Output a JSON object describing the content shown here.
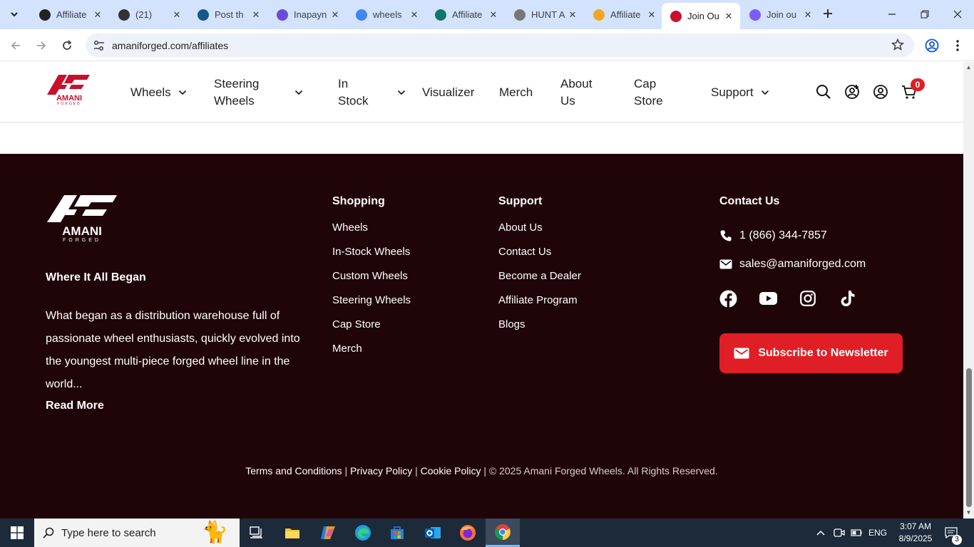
{
  "browser": {
    "tabs": [
      {
        "title": "Affiliate",
        "favicon": "chatgpt-icon",
        "color": "#222222"
      },
      {
        "title": "(21)",
        "favicon": "b-icon",
        "color": "#333333"
      },
      {
        "title": "Post th",
        "favicon": "xf-icon",
        "color": "#185886"
      },
      {
        "title": "Inapayn",
        "favicon": "e-icon",
        "color": "#6b4cd6"
      },
      {
        "title": "wheels",
        "favicon": "google-icon",
        "color": "#4285f4"
      },
      {
        "title": "Affiliate",
        "favicon": "shield-check-icon",
        "color": "#0f766e"
      },
      {
        "title": "HUNT A",
        "favicon": "slash-icon",
        "color": "#777777"
      },
      {
        "title": "Affiliate",
        "favicon": "sun-icon",
        "color": "#f5a623"
      },
      {
        "title": "Join Ou",
        "favicon": "amani-icon",
        "color": "#c8102e"
      },
      {
        "title": "Join ou",
        "favicon": "globe-icon",
        "color": "#7c5cff"
      }
    ],
    "active_tab_index": 8,
    "address": "amaniforged.com/affiliates"
  },
  "header": {
    "nav": [
      {
        "label": "Wheels",
        "dropdown": true
      },
      {
        "label": "Steering\nWheels",
        "dropdown": true
      },
      {
        "label": "In\nStock",
        "dropdown": true
      },
      {
        "label": "Visualizer",
        "dropdown": false
      },
      {
        "label": "Merch",
        "dropdown": false
      },
      {
        "label": "About\nUs",
        "dropdown": false
      },
      {
        "label": "Cap\nStore",
        "dropdown": false
      },
      {
        "label": "Support",
        "dropdown": true
      }
    ],
    "cart_count": "0"
  },
  "footer": {
    "tagline": "Where It All Began",
    "description": "What began as a distribution warehouse full of passionate wheel enthusiasts, quickly evolved into the youngest multi-piece forged wheel line in the world...",
    "read_more": "Read More",
    "shopping": {
      "heading": "Shopping",
      "links": [
        "Wheels",
        "In-Stock Wheels",
        "Custom Wheels",
        "Steering Wheels",
        "Cap Store",
        "Merch"
      ]
    },
    "support": {
      "heading": "Support",
      "links": [
        "About Us",
        "Contact Us",
        "Become a Dealer",
        "Affiliate Program",
        "Blogs"
      ]
    },
    "contact": {
      "heading": "Contact Us",
      "phone": "1 (866) 344-7857",
      "email": "sales@amaniforged.com"
    },
    "newsletter_label": "Subscribe to Newsletter",
    "legal": {
      "terms": "Terms and Conditions",
      "privacy": "Privacy Policy",
      "cookie": "Cookie Policy",
      "copyright": "© 2025 Amani Forged Wheels. All Rights Reserved."
    },
    "brand_color": "#e01e26",
    "background": "#1f0508"
  },
  "taskbar": {
    "search_placeholder": "Type here to search",
    "language": "ENG",
    "time": "3:07 AM",
    "date": "8/9/2025",
    "notifications": "3"
  }
}
